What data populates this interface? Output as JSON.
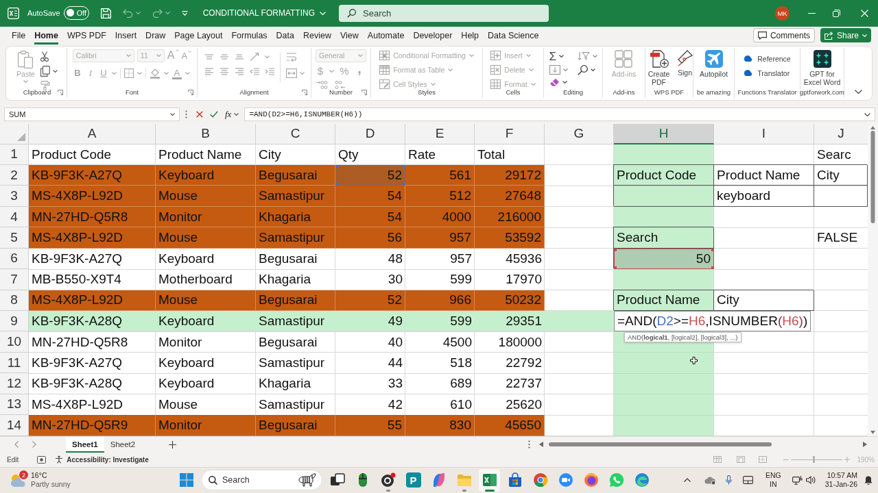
{
  "title_bar": {
    "autosave_label": "AutoSave",
    "autosave": {
      "on": false,
      "label": "Off"
    },
    "quick_access": [
      {
        "kind": "save",
        "disabled": false
      },
      {
        "kind": "undo",
        "disabled": true
      },
      {
        "kind": "redo",
        "disabled": true
      },
      {
        "kind": "customize",
        "disabled": false
      }
    ],
    "document_title": "CONDITIONAL FORMATTING",
    "search": {
      "placeholder": "Search"
    },
    "avatar": "MK"
  },
  "menu_tabs": [
    {
      "label": "File",
      "selected": false
    },
    {
      "label": "Home",
      "selected": true
    },
    {
      "label": "WPS PDF",
      "selected": false
    },
    {
      "label": "Insert",
      "selected": false
    },
    {
      "label": "Draw",
      "selected": false
    },
    {
      "label": "Page Layout",
      "selected": false
    },
    {
      "label": "Formulas",
      "selected": false
    },
    {
      "label": "Data",
      "selected": false
    },
    {
      "label": "Review",
      "selected": false
    },
    {
      "label": "View",
      "selected": false
    },
    {
      "label": "Automate",
      "selected": false
    },
    {
      "label": "Developer",
      "selected": false
    },
    {
      "label": "Help",
      "selected": false
    },
    {
      "label": "Data Science",
      "selected": false
    }
  ],
  "comments_button": "Comments",
  "share_button": "Share",
  "ribbon": {
    "groups": [
      {
        "kind": "clipboard",
        "label": "Clipboard",
        "launcher": true,
        "disabled": true,
        "paste": "Paste"
      },
      {
        "kind": "font",
        "label": "Font",
        "launcher": true,
        "disabled": true,
        "font_name": "Calibri",
        "font_size": "11",
        "grow": "A",
        "shrink": "A",
        "bold": "B",
        "italic": "I",
        "underline": "U",
        "font_color": "A"
      },
      {
        "kind": "alignment",
        "label": "Alignment",
        "launcher": true,
        "disabled": true
      },
      {
        "kind": "number",
        "label": "Number",
        "launcher": true,
        "disabled": true,
        "format": "General",
        "currency": "$",
        "percent": "%",
        "comma": ","
      },
      {
        "kind": "list",
        "label": "Styles",
        "launcher": false,
        "disabled": true,
        "items": [
          {
            "kind": "conditional",
            "label": "Conditional Formatting",
            "dropdown": true
          },
          {
            "kind": "table",
            "label": "Format as Table",
            "dropdown": true
          },
          {
            "kind": "styles",
            "label": "Cell Styles",
            "dropdown": true
          }
        ]
      },
      {
        "kind": "list",
        "label": "Cells",
        "launcher": false,
        "disabled": true,
        "items": [
          {
            "kind": "insert",
            "label": "Insert",
            "dropdown": true
          },
          {
            "kind": "delete",
            "label": "Delete",
            "dropdown": true
          },
          {
            "kind": "format",
            "label": "Format",
            "dropdown": true
          }
        ]
      },
      {
        "kind": "editing",
        "label": "Editing",
        "launcher": false,
        "disabled": false,
        "autosum": "Σ"
      },
      {
        "kind": "large",
        "label": "Add-ins",
        "launcher": false,
        "disabled": true,
        "items": [
          {
            "kind": "addins",
            "label": "Add-ins"
          }
        ]
      },
      {
        "kind": "large",
        "label": "WPS PDF",
        "launcher": false,
        "disabled": false,
        "items": [
          {
            "kind": "pdf",
            "label": "Create PDF"
          },
          {
            "kind": "sign",
            "label": "Sign"
          }
        ]
      },
      {
        "kind": "large",
        "label": "be amazing",
        "launcher": false,
        "disabled": false,
        "items": [
          {
            "kind": "autopilot",
            "label": "Autopilot"
          }
        ]
      },
      {
        "kind": "list",
        "label": "Functions Translator",
        "launcher": false,
        "disabled": false,
        "items": [
          {
            "kind": "reference",
            "label": "Reference",
            "dropdown": false
          },
          {
            "kind": "translator",
            "label": "Translator",
            "dropdown": false
          }
        ]
      },
      {
        "kind": "large",
        "label": "gptforwork.com",
        "launcher": false,
        "disabled": false,
        "items": [
          {
            "kind": "gpt",
            "label": "GPT for Excel Word"
          }
        ]
      }
    ]
  },
  "formula_bar": {
    "name_box": "SUM",
    "function_button": "fx",
    "formula": "=AND(D2>=H6,ISNUMBER(H6))"
  },
  "sheet": {
    "columns": [
      {
        "label": "A",
        "selected": false
      },
      {
        "label": "B",
        "selected": false
      },
      {
        "label": "C",
        "selected": false
      },
      {
        "label": "D",
        "selected": false
      },
      {
        "label": "E",
        "selected": false
      },
      {
        "label": "F",
        "selected": false
      },
      {
        "label": "G",
        "selected": false
      },
      {
        "label": "H",
        "selected": true
      },
      {
        "label": "I",
        "selected": false
      },
      {
        "label": "J",
        "selected": false
      }
    ],
    "rows": [
      {
        "number": "1",
        "kind": "plain",
        "table": [
          "Product Code",
          "Product Name",
          "City",
          "Qty",
          "Rate",
          "Total"
        ],
        "extra": [
          {
            "bordered": false
          },
          {
            "bordered": false
          },
          {
            "bordered": false
          },
          {
            "text": "Searc",
            "bordered": false
          }
        ]
      },
      {
        "number": "2",
        "kind": "match",
        "table": [
          "KB-9F3K-A27Q",
          "Keyboard",
          "Begusarai",
          {
            "text": "52",
            "color": "#4472c4"
          },
          "561",
          "29172"
        ],
        "extra": [
          {
            "bordered": false
          },
          {
            "text": "Product Code",
            "bordered": true
          },
          {
            "text": "Product Name",
            "bordered": true
          },
          {
            "text": "City",
            "bordered": true
          }
        ]
      },
      {
        "number": "3",
        "kind": "match",
        "table": [
          "MS-4X8P-L92D",
          "Mouse",
          "Samastipur",
          "54",
          "512",
          "27648"
        ],
        "extra": [
          {
            "bordered": false
          },
          {
            "bordered": true
          },
          {
            "text": "keyboard",
            "bordered": true
          },
          {
            "bordered": true
          }
        ]
      },
      {
        "number": "4",
        "kind": "match",
        "table": [
          "MN-27HD-Q5R8",
          "Monitor",
          "Khagaria",
          "54",
          "4000",
          "216000"
        ]
      },
      {
        "number": "5",
        "kind": "match",
        "table": [
          "MS-4X8P-L92D",
          "Mouse",
          "Samastipur",
          "56",
          "957",
          "53592"
        ],
        "extra": [
          {
            "bordered": false
          },
          {
            "text": "Search",
            "bordered": true
          },
          {
            "bordered": false
          },
          {
            "text": "FALSE",
            "bordered": false
          }
        ]
      },
      {
        "number": "6",
        "kind": "plain",
        "table": [
          "KB-9F3K-A27Q",
          "Keyboard",
          "Begusarai",
          "48",
          "957",
          "45936"
        ],
        "extra": [
          {
            "bordered": false
          },
          {
            "text": "50",
            "bordered": true,
            "color": "#c0504d"
          }
        ]
      },
      {
        "number": "7",
        "kind": "plain",
        "table": [
          "MB-B550-X9T4",
          "Motherboard",
          "Khagaria",
          "30",
          "599",
          "17970"
        ]
      },
      {
        "number": "8",
        "kind": "match",
        "table": [
          "MS-4X8P-L92D",
          "Mouse",
          "Begusarai",
          "52",
          "966",
          "50232"
        ],
        "extra": [
          {
            "bordered": false
          },
          {
            "text": "Product Name",
            "bordered": true
          },
          {
            "text": "City",
            "bordered": true
          }
        ]
      },
      {
        "number": "9",
        "kind": "focus",
        "table": [
          "KB-9F3K-A28Q",
          "Keyboard",
          "Samastipur",
          "49",
          "599",
          "29351"
        ]
      },
      {
        "number": "10",
        "kind": "plain",
        "table": [
          "MN-27HD-Q5R8",
          "Monitor",
          "Begusarai",
          "40",
          "4500",
          "180000"
        ]
      },
      {
        "number": "11",
        "kind": "plain",
        "table": [
          "KB-9F3K-A27Q",
          "Keyboard",
          "Samastipur",
          "44",
          "518",
          "22792"
        ]
      },
      {
        "number": "12",
        "kind": "plain",
        "table": [
          "KB-9F3K-A28Q",
          "Keyboard",
          "Khagaria",
          "33",
          "689",
          "22737"
        ]
      },
      {
        "number": "13",
        "kind": "plain",
        "table": [
          "MS-4X8P-L92D",
          "Mouse",
          "Samastipur",
          "42",
          "610",
          "25620"
        ]
      },
      {
        "number": "14",
        "kind": "match",
        "table": [
          "MN-27HD-Q5R9",
          "Monitor",
          "Begusarai",
          "55",
          "830",
          "45650"
        ]
      }
    ],
    "cell_editor": {
      "segments": [
        {
          "text": "=AND("
        },
        {
          "text": "D2",
          "color": "#4472c4"
        },
        {
          "text": ">="
        },
        {
          "text": "H6",
          "color": "#c0504d"
        },
        {
          "text": ",ISNUMBER"
        },
        {
          "text": "(",
          "color": "#9e2a4b"
        },
        {
          "text": "H6",
          "color": "#c0504d"
        },
        {
          "text": ")",
          "color": "#9e2a4b"
        },
        {
          "text": ")"
        }
      ],
      "tooltip": "AND(**logical1**, [logical2], [logical3], ...)"
    }
  },
  "sheet_tabs": [
    {
      "label": "Sheet1",
      "selected": true
    },
    {
      "label": "Sheet2",
      "selected": false
    }
  ],
  "status_bar": {
    "mode": "Edit",
    "accessibility": "Accessibility: Investigate",
    "zoom": {
      "level": 0.44,
      "label": "190%",
      "disabled": true
    }
  },
  "taskbar": {
    "weather": {
      "badge": "2",
      "temperature": "16°C",
      "condition": "Partly sunny"
    },
    "search": {
      "placeholder": "Search"
    },
    "apps": [
      {
        "kind": "taskview",
        "running": false,
        "active": false
      },
      {
        "kind": "mouse",
        "running": false,
        "active": false
      },
      {
        "kind": "recorder",
        "running": true,
        "active": false
      },
      {
        "kind": "tile",
        "label": "P",
        "running": false,
        "active": false
      },
      {
        "kind": "copilot",
        "running": false,
        "active": false
      },
      {
        "kind": "folder",
        "running": true,
        "active": false
      },
      {
        "kind": "spreadsheet",
        "running": true,
        "active": true
      },
      {
        "kind": "store",
        "running": false,
        "active": false
      },
      {
        "kind": "chrome",
        "running": false,
        "active": false
      },
      {
        "kind": "meeting",
        "running": false,
        "active": false
      },
      {
        "kind": "firefox",
        "running": false,
        "active": false
      },
      {
        "kind": "whatsapp",
        "running": false,
        "active": false
      },
      {
        "kind": "edge",
        "running": false,
        "active": false
      }
    ],
    "language": [
      "ENG",
      "IN"
    ],
    "time": "10:57 AM",
    "date": "31-Jan-26"
  }
}
